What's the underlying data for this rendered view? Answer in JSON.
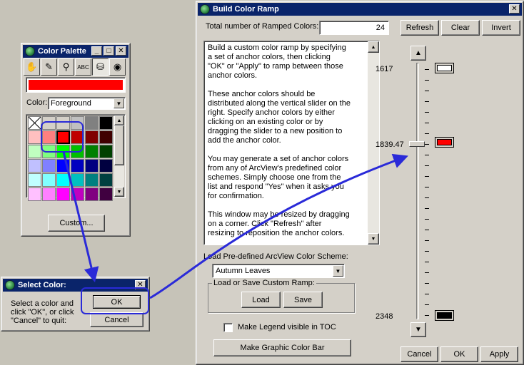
{
  "palette_window": {
    "title": "Color Palette",
    "tools": [
      {
        "icon": "hand-icon",
        "glyph": "✋"
      },
      {
        "icon": "pen-icon",
        "glyph": "✎"
      },
      {
        "icon": "brush-icon",
        "glyph": "⚲"
      },
      {
        "icon": "text-abc-icon",
        "glyph": "ABC"
      },
      {
        "icon": "paint-bucket-icon",
        "glyph": "⛁"
      },
      {
        "icon": "palette-icon",
        "glyph": "◉"
      }
    ],
    "current_color": "#ff0000",
    "color_label": "Color:",
    "color_value": "Foreground",
    "custom_button": "Custom...",
    "swatches": [
      [
        "none",
        "#d4d0c8",
        "#d4d0c8",
        "#c0c0c0",
        "#808080",
        "#000000"
      ],
      [
        "#ffc0c0",
        "#ff8080",
        "#ff0000",
        "#c00000",
        "#800000",
        "#400000"
      ],
      [
        "#c0ffc0",
        "#80ff80",
        "#00ff00",
        "#00c000",
        "#008000",
        "#004000"
      ],
      [
        "#c0c0ff",
        "#8080ff",
        "#0000ff",
        "#0000c0",
        "#000080",
        "#000040"
      ],
      [
        "#c0ffff",
        "#80ffff",
        "#00ffff",
        "#00c0c0",
        "#008080",
        "#004040"
      ],
      [
        "#ffc0ff",
        "#ff80ff",
        "#ff00ff",
        "#c000c0",
        "#800080",
        "#400040"
      ]
    ]
  },
  "select_window": {
    "title": "Select Color:",
    "message_1": "Select a color and",
    "message_2": "click \"OK\", or click",
    "message_3": "\"Cancel\" to quit:",
    "ok": "OK",
    "cancel": "Cancel"
  },
  "ramp_window": {
    "title": "Build Color Ramp",
    "total_label": "Total number of Ramped Colors:",
    "total_value": "24",
    "refresh": "Refresh",
    "clear": "Clear",
    "invert": "Invert",
    "help_lines": [
      "Build a custom color ramp by specifying",
      "a set of anchor colors, then clicking",
      "\"OK\" or \"Apply\" to ramp between those",
      "anchor colors.",
      "",
      "These anchor colors should be",
      "distributed along the vertical slider on the",
      "right.  Specify anchor colors by either",
      "clicking on an existing color or by",
      "dragging the slider to a new position to",
      "add the anchor color.",
      "",
      "You may generate a set of anchor colors",
      "from any of ArcView's predefined color",
      "schemes.  Simply choose one from the",
      "list and respond \"Yes\" when it asks you",
      "for confirmation.",
      "",
      "This window may be resized by dragging",
      "on a corner.  Click \"Refresh\" after",
      "resizing to reposition the anchor colors."
    ],
    "scheme_label": "Load Pre-defined ArcView Color Scheme:",
    "scheme_value": "Autumn Leaves",
    "group_label": "Load or Save Custom Ramp:",
    "load": "Load",
    "save": "Save",
    "legend_label": "Make Legend visible in TOC",
    "legend_checked": false,
    "graphic_bar": "Make Graphic Color Bar",
    "cancel": "Cancel",
    "ok": "OK",
    "apply": "Apply",
    "anchor_top_value": "1617",
    "anchor_mid_value": "1839.47",
    "anchor_bottom_value": "2348",
    "anchor_top_color": "#ffffff",
    "anchor_mid_color": "#ff0000",
    "anchor_bottom_color": "#000000"
  }
}
